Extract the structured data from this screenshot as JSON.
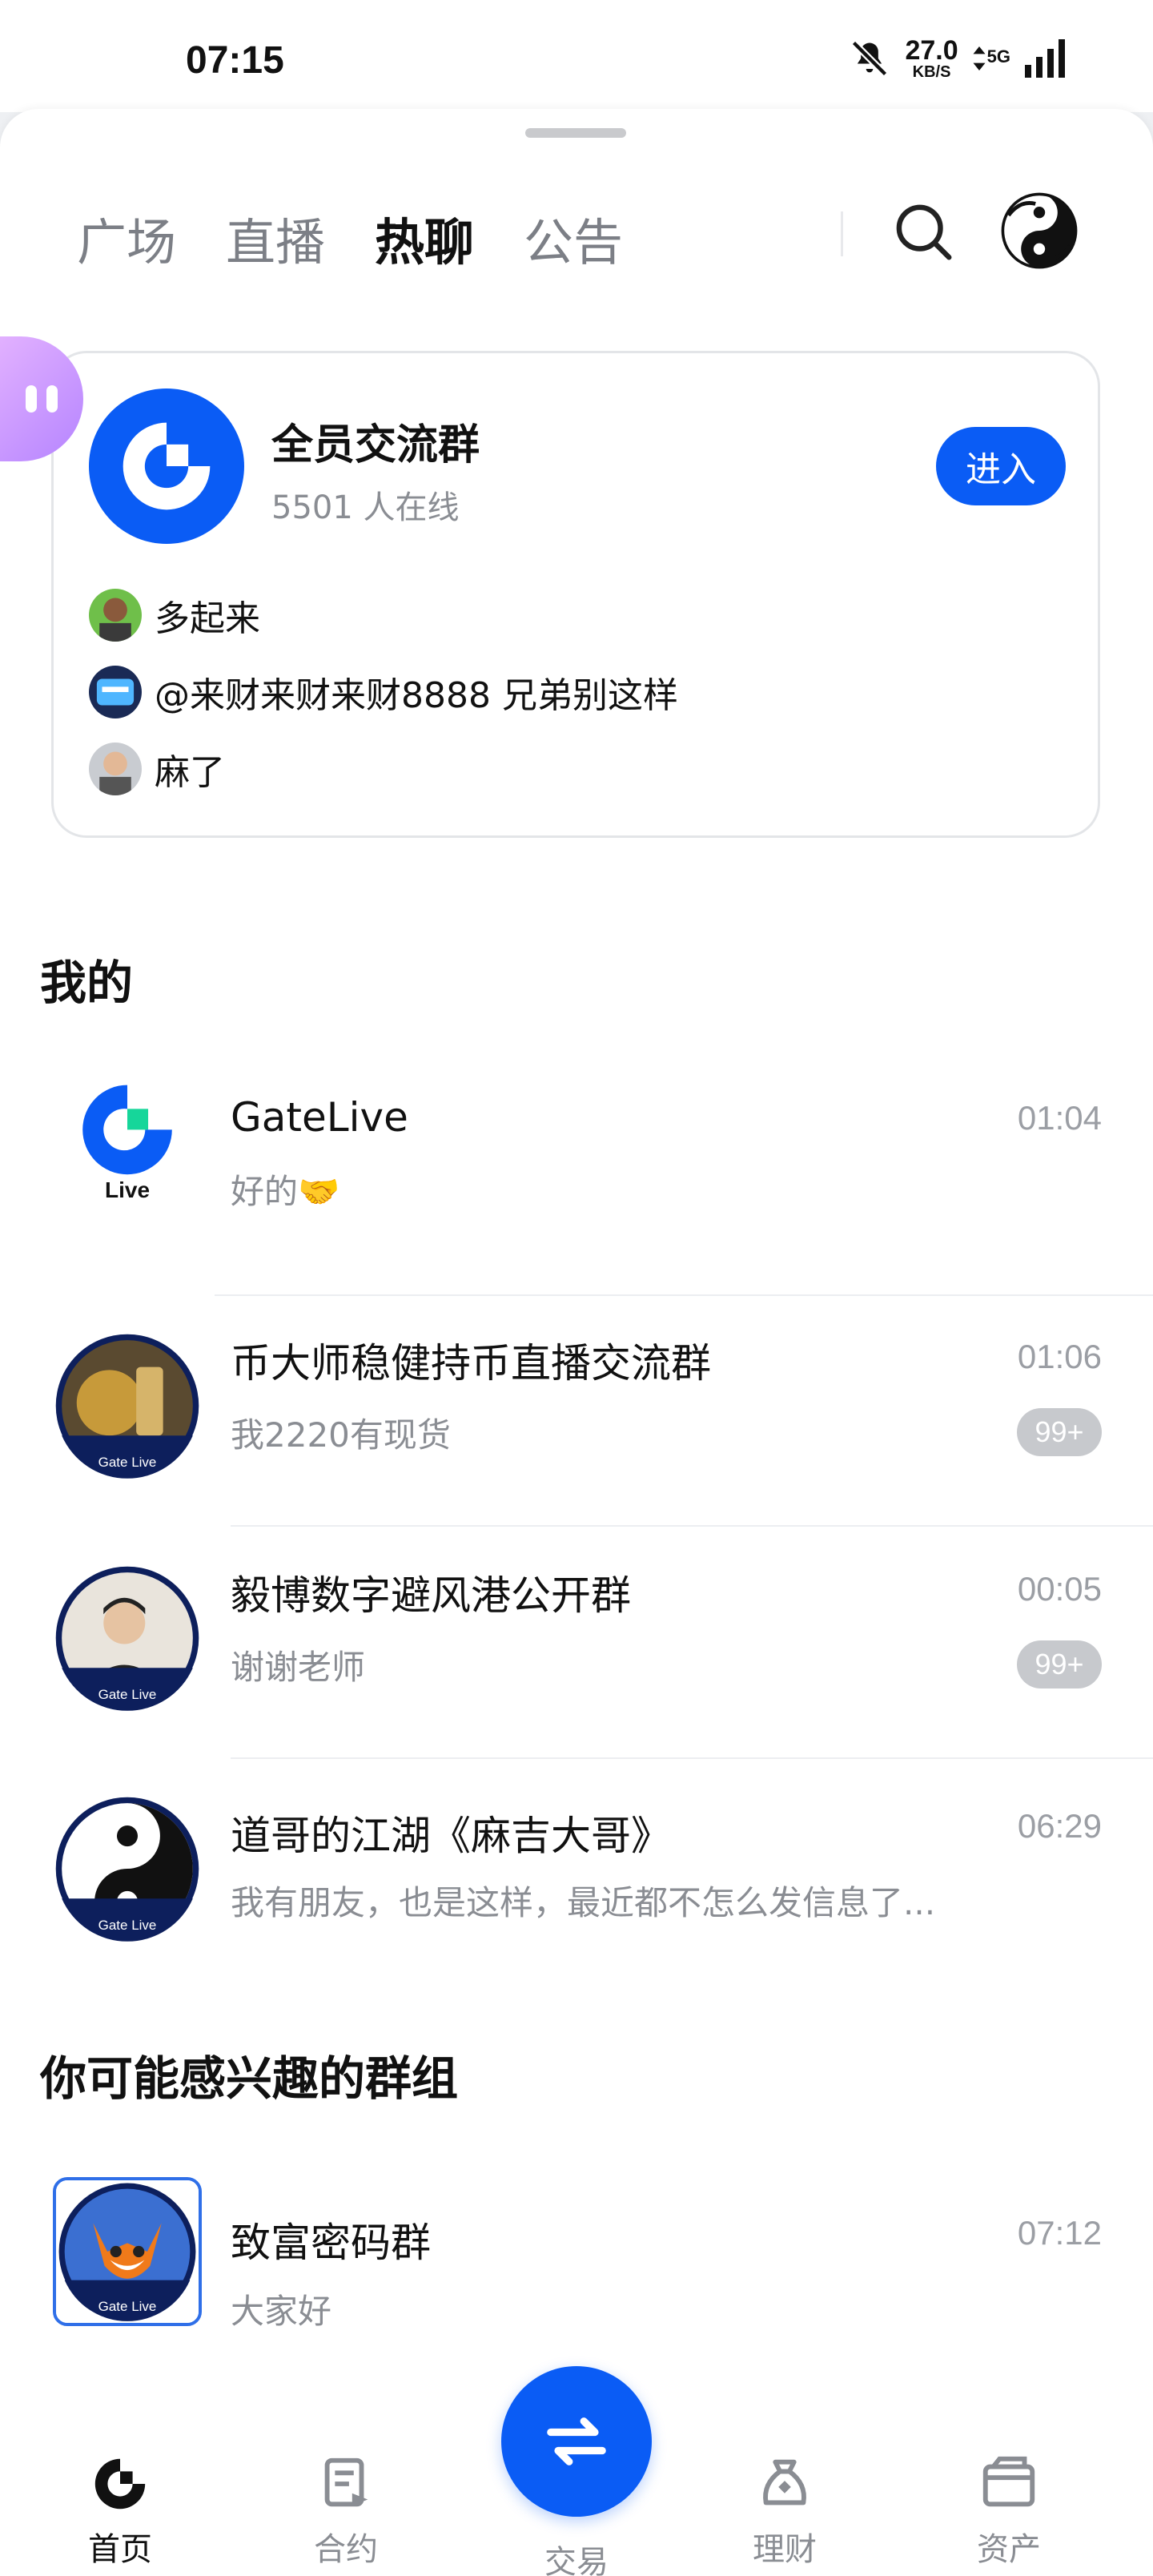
{
  "status": {
    "time": "07:15",
    "net_speed": "27.0",
    "net_unit": "KB/S",
    "network": "5G"
  },
  "tabs": [
    {
      "label": "广场",
      "active": false
    },
    {
      "label": "直播",
      "active": false
    },
    {
      "label": "热聊",
      "active": true
    },
    {
      "label": "公告",
      "active": false
    }
  ],
  "featured": {
    "title": "全员交流群",
    "online": "5501 人在线",
    "enter_label": "进入",
    "messages": [
      {
        "text": "多起来"
      },
      {
        "text": "@来财来财来财8888 兄弟别这样"
      },
      {
        "text": "麻了"
      }
    ]
  },
  "mine": {
    "title": "我的",
    "chats": [
      {
        "name": "GateLive",
        "message": "好的🤝",
        "time": "01:04",
        "badge": ""
      },
      {
        "name": "币大师稳健持币直播交流群",
        "message": "我2220有现货",
        "time": "01:06",
        "badge": "99+"
      },
      {
        "name": "毅博数字避风港公开群",
        "message": "谢谢老师",
        "time": "00:05",
        "badge": "99+"
      },
      {
        "name": "道哥的江湖《麻吉大哥》",
        "message": "我有朋友，也是这样，最近都不怎么发信息了...",
        "time": "06:29",
        "badge": ""
      }
    ]
  },
  "suggested": {
    "title": "你可能感兴趣的群组",
    "chats": [
      {
        "name": "致富密码群",
        "message": "大家好",
        "time": "07:12"
      }
    ]
  },
  "avatar_caption": "Gate Live",
  "live_caption": "Live",
  "bottom_nav": {
    "home": "首页",
    "contract": "合约",
    "trade": "交易",
    "finance": "理财",
    "assets": "资产"
  },
  "colors": {
    "accent": "#0a5cf5",
    "badge": "#c7c9cd",
    "muted": "#8a8d93"
  }
}
